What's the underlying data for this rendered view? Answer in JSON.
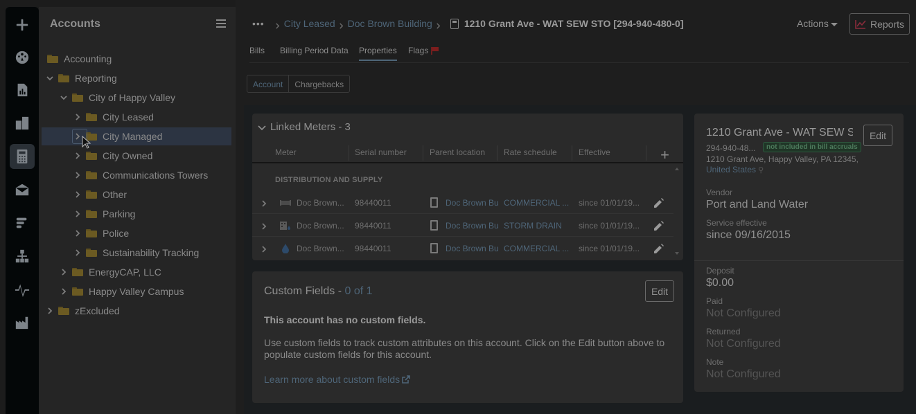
{
  "rail": {
    "items": [
      {
        "icon": "plus-icon"
      },
      {
        "icon": "dashboard-icon"
      },
      {
        "icon": "report-chart-icon"
      },
      {
        "icon": "buildings-icon"
      },
      {
        "icon": "calculator-icon",
        "active": true
      },
      {
        "icon": "mail-icon"
      },
      {
        "icon": "bars-icon"
      },
      {
        "icon": "hierarchy-icon"
      },
      {
        "icon": "pulse-icon"
      },
      {
        "icon": "factory-icon"
      }
    ]
  },
  "tree": {
    "title": "Accounts",
    "items": [
      {
        "label": "Accounting",
        "level": 0,
        "expanded": false,
        "chevron": false
      },
      {
        "label": "Reporting",
        "level": 0,
        "expanded": true,
        "chevron": true
      },
      {
        "label": "City of Happy Valley",
        "level": 1,
        "expanded": true,
        "chevron": true
      },
      {
        "label": "City Leased",
        "level": 2,
        "chevron": true
      },
      {
        "label": "City Managed",
        "level": 2,
        "chevron": true,
        "selected": true
      },
      {
        "label": "City Owned",
        "level": 2,
        "chevron": true
      },
      {
        "label": "Communications Towers",
        "level": 2,
        "chevron": true
      },
      {
        "label": "Other",
        "level": 2,
        "chevron": true
      },
      {
        "label": "Parking",
        "level": 2,
        "chevron": true
      },
      {
        "label": "Police",
        "level": 2,
        "chevron": true
      },
      {
        "label": "Sustainability Tracking",
        "level": 2,
        "chevron": true
      },
      {
        "label": "EnergyCAP, LLC",
        "level": 1,
        "chevron": true
      },
      {
        "label": "Happy Valley Campus",
        "level": 1,
        "chevron": true
      },
      {
        "label": "zExcluded",
        "level": 0,
        "chevron": true
      }
    ]
  },
  "breadcrumb": {
    "ellipsis": "•••",
    "items": [
      "City Leased",
      "Doc Brown Building"
    ],
    "current": "1210 Grant Ave - WAT SEW STO [294-940-480-0]"
  },
  "header": {
    "actions_label": "Actions",
    "reports_label": "Reports"
  },
  "tabs": [
    {
      "label": "Bills"
    },
    {
      "label": "Billing Period Data"
    },
    {
      "label": "Properties",
      "active": true
    },
    {
      "label": "Flags"
    }
  ],
  "subtabs": [
    "Account",
    "Chargebacks"
  ],
  "meters": {
    "title": "Linked Meters - 3",
    "columns": [
      "Meter",
      "Serial number",
      "Parent location",
      "Rate schedule",
      "Effective"
    ],
    "group": "DISTRIBUTION AND SUPPLY",
    "rows": [
      {
        "icon": "meter-bar-icon",
        "meter": "Doc Brown...",
        "serial": "98440011",
        "location": "Doc Brown Bu",
        "rate": "COMMERCIAL ...",
        "effective": "since 01/01/19..."
      },
      {
        "icon": "storm-drain-icon",
        "meter": "Doc Brown...",
        "serial": "98440011",
        "location": "Doc Brown Bu",
        "rate": "STORM DRAIN",
        "effective": "since 01/01/19..."
      },
      {
        "icon": "water-drop-icon",
        "meter": "Doc Brown...",
        "serial": "98440011",
        "location": "Doc Brown Bu",
        "rate": "COMMERCIAL ...",
        "effective": "since 01/01/19..."
      }
    ]
  },
  "custom_fields": {
    "title": "Custom Fields - ",
    "count": "0 of 1",
    "edit_label": "Edit",
    "empty_title": "This account has no custom fields.",
    "description": "Use custom fields to track custom attributes on this account. Click on the Edit button above to populate custom fields for this account.",
    "learn_more": "Learn more about custom fields"
  },
  "info": {
    "title": "1210 Grant Ave - WAT SEW S...",
    "edit_label": "Edit",
    "code": "294-940-48...",
    "badge": "not included in bill accruals",
    "address": "1210 Grant Ave, Happy Valley, PA 12345,",
    "country": "United States",
    "vendor_label": "Vendor",
    "vendor": "Port and Land Water",
    "service_label": "Service effective",
    "service": "since 09/16/2015",
    "deposit_label": "Deposit",
    "deposit": "$0.00",
    "paid_label": "Paid",
    "paid": "Not Configured",
    "returned_label": "Returned",
    "returned": "Not Configured",
    "note_label": "Note",
    "note": "Not Configured"
  }
}
